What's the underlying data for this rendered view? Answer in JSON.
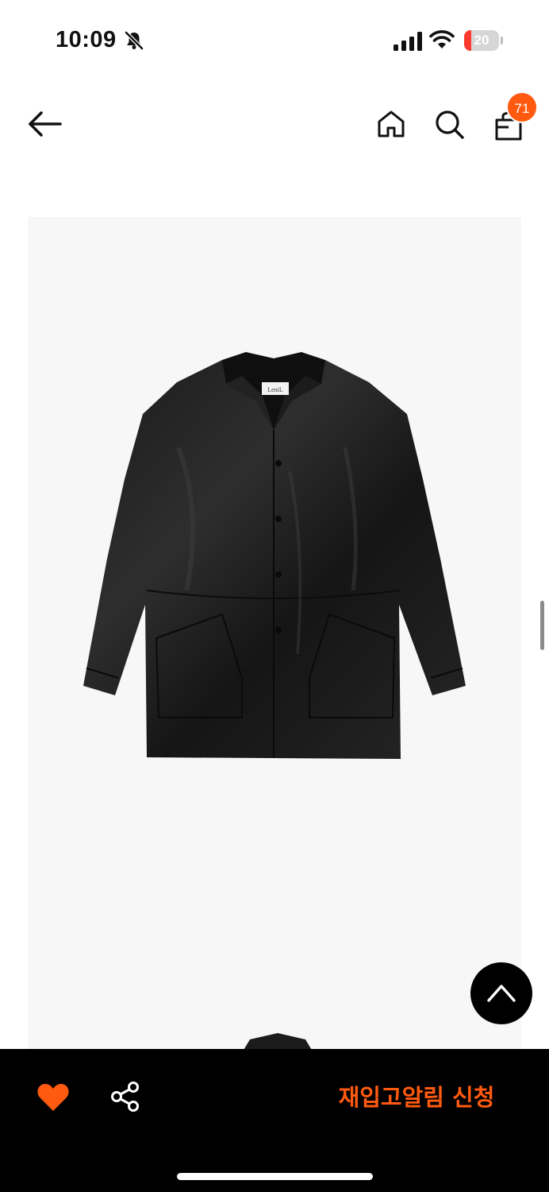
{
  "status_bar": {
    "time": "10:09",
    "battery_level": "20",
    "battery_percent": 20
  },
  "header": {
    "icons": [
      "back-arrow-icon",
      "home-icon",
      "search-icon",
      "shopping-bag-icon"
    ],
    "cart_count": "71"
  },
  "product": {
    "label_text": "LeniL"
  },
  "bottom_bar": {
    "restock_label": "재입고알림 신청",
    "icons": [
      "heart-icon",
      "share-icon"
    ]
  },
  "colors": {
    "accent": "#ff5a10",
    "bottom_bar": "#000000",
    "image_background": "#f7f7f7"
  }
}
